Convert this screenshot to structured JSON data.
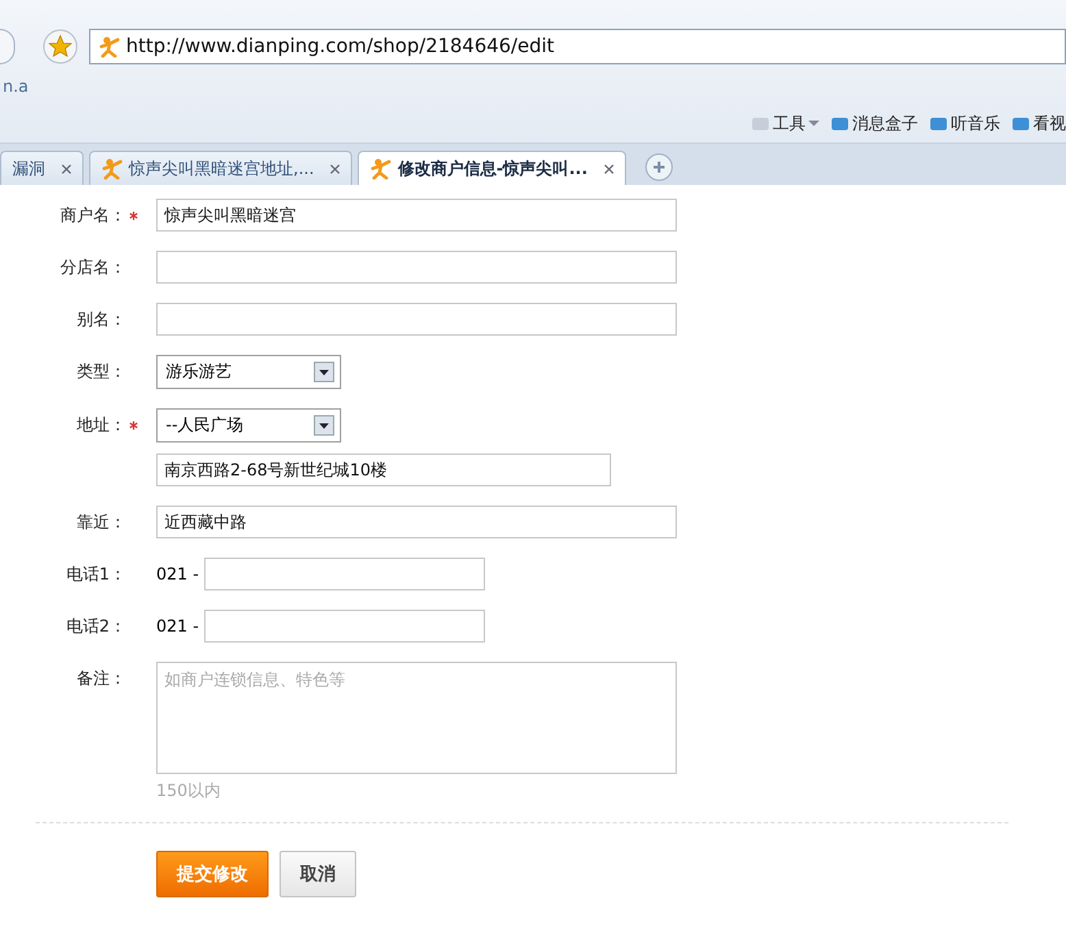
{
  "browser": {
    "address": "http://www.dianping.com/shop/2184646/edit",
    "bookmarks": [
      "n.a"
    ],
    "toolbar": [
      {
        "label": "工具",
        "kind": "menu"
      },
      {
        "label": "消息盒子",
        "kind": "plain"
      },
      {
        "label": "听音乐",
        "kind": "plain"
      },
      {
        "label": "看视",
        "kind": "plain"
      }
    ],
    "tabs": [
      {
        "label": "漏洞",
        "selected": false
      },
      {
        "label": "惊声尖叫黑暗迷宫地址,...",
        "selected": false
      },
      {
        "label": "修改商户信息-惊声尖叫...",
        "selected": true
      }
    ]
  },
  "form": {
    "fields": [
      {
        "label": "商户名：",
        "required": true,
        "kind": "text",
        "value": "惊声尖叫黑暗迷宫"
      },
      {
        "label": "分店名：",
        "required": false,
        "kind": "text"
      },
      {
        "label": "别名：",
        "required": false,
        "kind": "text"
      },
      {
        "label": "类型：",
        "required": false,
        "kind": "select",
        "value": "游乐游艺"
      },
      {
        "label": "地址：",
        "required": true,
        "kind": "address",
        "value": "--人民广场",
        "detail": "南京西路2-68号新世纪城10楼"
      },
      {
        "label": "靠近：",
        "required": false,
        "kind": "text",
        "value": "近西藏中路"
      },
      {
        "label": "电话1：",
        "required": false,
        "kind": "phone",
        "prefix": "021 -"
      },
      {
        "label": "电话2：",
        "required": false,
        "kind": "phone",
        "prefix": "021 -"
      },
      {
        "label": "备注：",
        "required": false,
        "kind": "textarea",
        "placeholder": "如商户连锁信息、特色等",
        "hint": "150以内"
      }
    ],
    "buttons": [
      {
        "label": "提交修改",
        "kind": "primary"
      },
      {
        "label": "取消",
        "kind": "secondary"
      }
    ]
  }
}
